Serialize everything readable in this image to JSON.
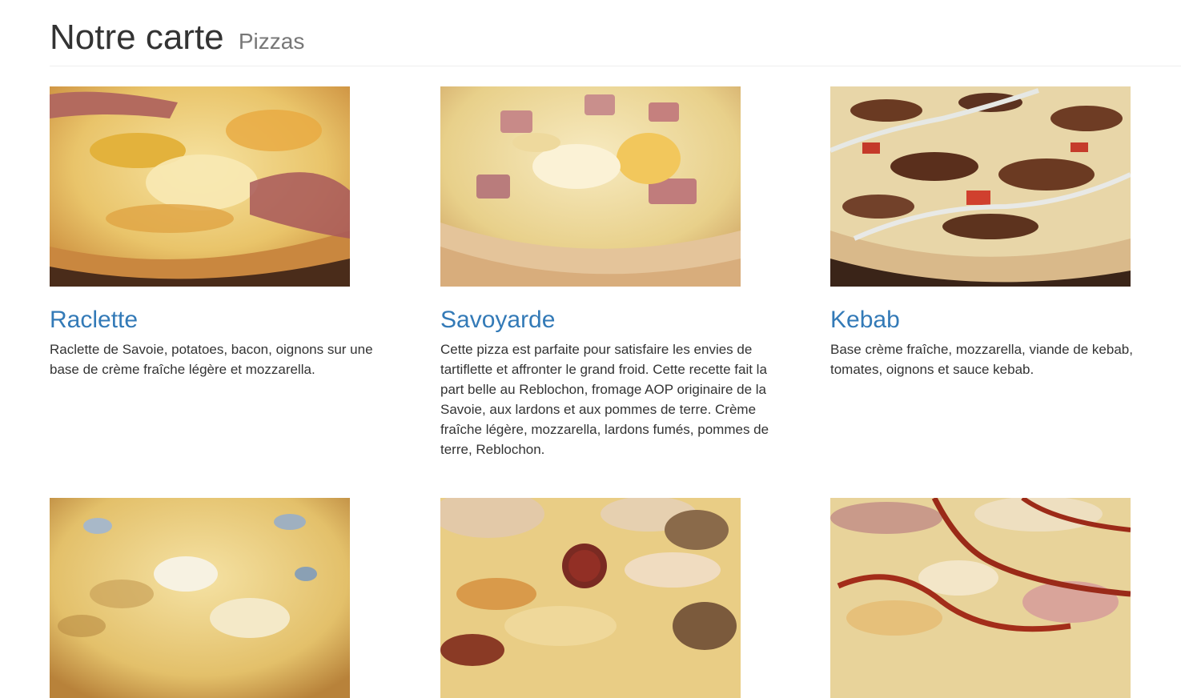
{
  "header": {
    "title": "Notre carte",
    "subtitle": "Pizzas"
  },
  "pizzas": [
    {
      "name": "Raclette",
      "description": "Raclette de Savoie, potatoes, bacon, oignons sur une base de crème fraîche légère et mozzarella.",
      "image": "raclette-pizza-photo"
    },
    {
      "name": "Savoyarde",
      "description": "Cette pizza est parfaite pour satisfaire les envies de tartiflette et affronter le grand froid. Cette recette fait la part belle au Reblochon, fromage AOP originaire de la Savoie, aux lardons et aux pommes de terre. Crème fraîche légère, mozzarella, lardons fumés, pommes de terre, Reblochon.",
      "image": "savoyarde-pizza-photo"
    },
    {
      "name": "Kebab",
      "description": "Base crème fraîche, mozzarella, viande de kebab, tomates, oignons et sauce kebab.",
      "image": "kebab-pizza-photo"
    },
    {
      "image": "four-cheese-pizza-photo"
    },
    {
      "image": "chorizo-chicken-pizza-photo"
    },
    {
      "image": "bbq-chicken-pizza-photo"
    }
  ],
  "colors": {
    "link": "#337ab7",
    "text": "#333333",
    "subtitle": "#777777"
  }
}
